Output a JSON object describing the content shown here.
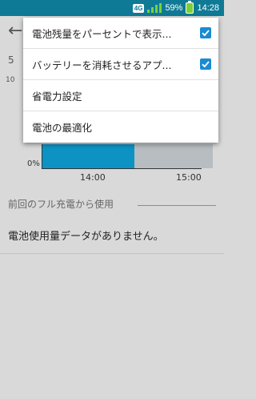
{
  "status_bar": {
    "network_badge": "4G",
    "battery_percent": "59%",
    "time": "14:28"
  },
  "screen": {
    "partial_heading": "5",
    "partial_axis_label": "10",
    "chart": {
      "zero_label": "0%",
      "x_ticks": [
        "14:00",
        "15:00"
      ]
    },
    "section_title": "前回のフル充電から使用",
    "empty_message": "電池使用量データがありません。"
  },
  "menu": {
    "items": [
      {
        "label": "電池残量をパーセントで表示...",
        "checked": true
      },
      {
        "label": "バッテリーを消耗させるアプ...",
        "checked": true
      },
      {
        "label": "省電力設定"
      },
      {
        "label": "電池の最適化"
      }
    ]
  },
  "colors": {
    "status_bar": "#0f7a96",
    "chart_fill": "#0c93c4",
    "checkbox": "#1a8bd2",
    "scrim": "#d9d9d9"
  }
}
